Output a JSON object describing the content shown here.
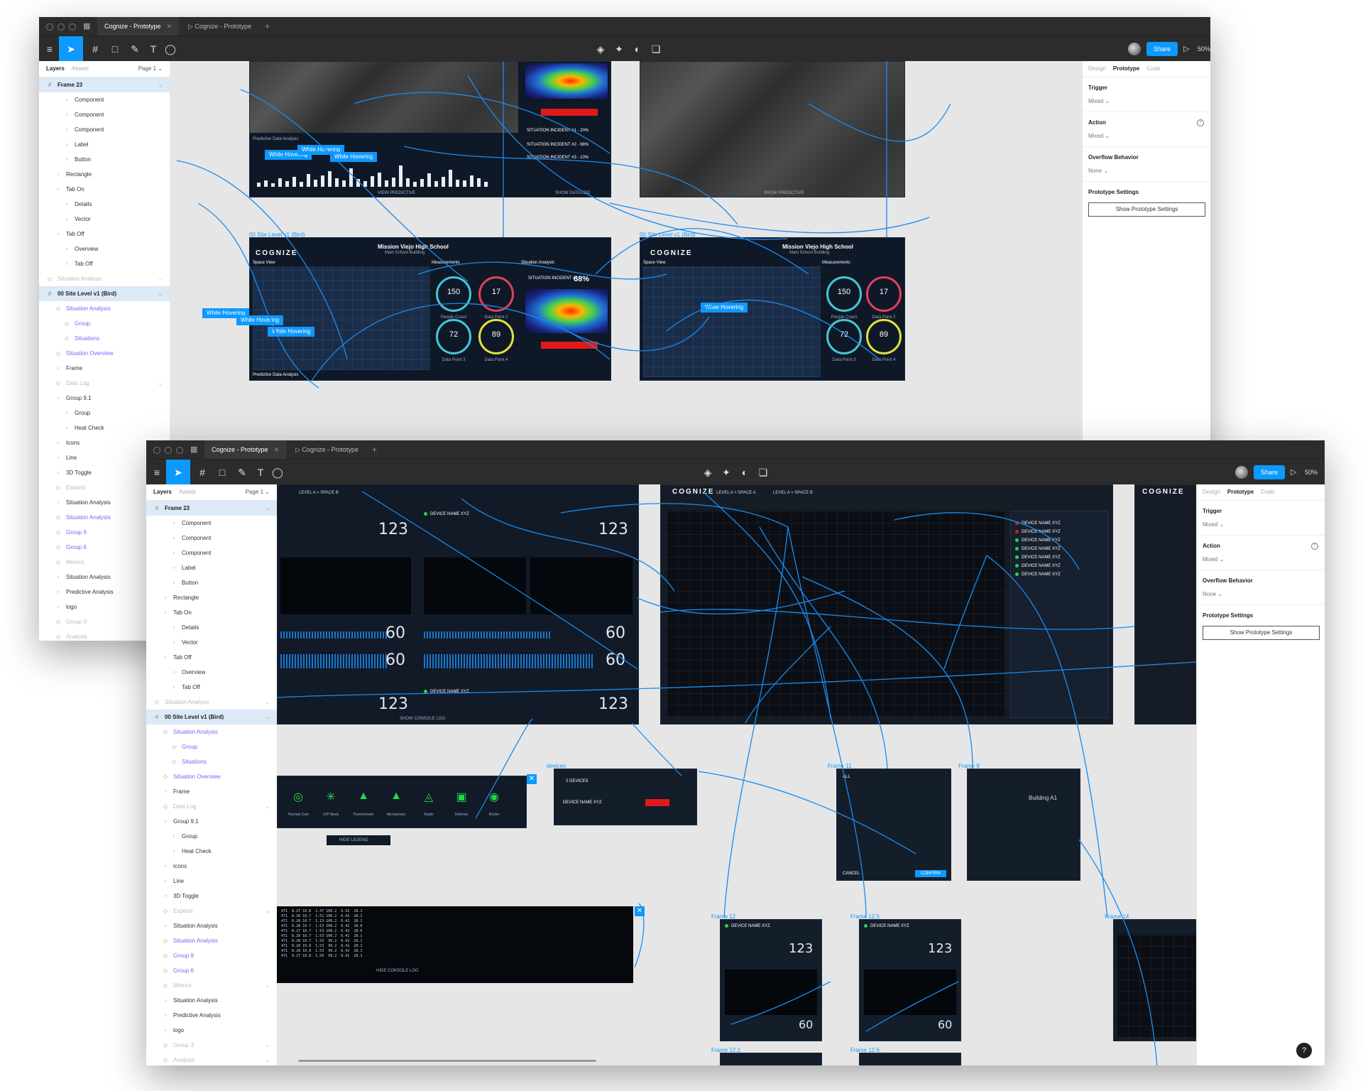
{
  "win1": {
    "tabs": [
      {
        "label": "Cognize - Prototype",
        "active": true
      },
      {
        "label": "Cognize - Prototype",
        "active": false
      }
    ],
    "zoom": "50%",
    "share_label": "Share",
    "layers_tab": "Layers",
    "assets_tab": "Assets",
    "page_label": "Page 1",
    "layers": [
      {
        "label": "Frame 23",
        "type": "frame"
      },
      {
        "label": "Component",
        "type": "normal"
      },
      {
        "label": "Component",
        "type": "normal"
      },
      {
        "label": "Component",
        "type": "normal"
      },
      {
        "label": "Label",
        "type": "normal"
      },
      {
        "label": "Button",
        "type": "normal"
      },
      {
        "label": "Rectangle",
        "type": "normal"
      },
      {
        "label": "Tab On",
        "type": "normal"
      },
      {
        "label": "Details",
        "type": "normal"
      },
      {
        "label": "Vector",
        "type": "normal"
      },
      {
        "label": "Tab Off",
        "type": "normal"
      },
      {
        "label": "Overview",
        "type": "normal"
      },
      {
        "label": "Tab Off",
        "type": "normal"
      },
      {
        "label": "Situation Analysis",
        "type": "faded"
      },
      {
        "label": "00 Site Level v1 (Bird)",
        "type": "frame"
      },
      {
        "label": "Situation Analysis",
        "type": "comp"
      },
      {
        "label": "Group",
        "type": "comp"
      },
      {
        "label": "Situations",
        "type": "comp"
      },
      {
        "label": "Situation Overview",
        "type": "comp"
      },
      {
        "label": "Frame",
        "type": "normal"
      },
      {
        "label": "Data Log",
        "type": "faded"
      },
      {
        "label": "Group 9.1",
        "type": "normal"
      },
      {
        "label": "Group",
        "type": "normal"
      },
      {
        "label": "Heat Check",
        "type": "normal"
      },
      {
        "label": "Icons",
        "type": "normal"
      },
      {
        "label": "Line",
        "type": "normal"
      },
      {
        "label": "3D Toggle",
        "type": "normal"
      },
      {
        "label": "Expand",
        "type": "faded"
      },
      {
        "label": "Situation Analysis",
        "type": "normal"
      },
      {
        "label": "Situation Analysis",
        "type": "comp"
      },
      {
        "label": "Group 9",
        "type": "comp"
      },
      {
        "label": "Group 6",
        "type": "comp"
      },
      {
        "label": "Metrics",
        "type": "faded"
      },
      {
        "label": "Situation Analysis",
        "type": "normal"
      },
      {
        "label": "Predictive Analysis",
        "type": "normal"
      },
      {
        "label": "logo",
        "type": "normal"
      },
      {
        "label": "Group 3",
        "type": "faded"
      },
      {
        "label": "Analysis",
        "type": "faded"
      }
    ],
    "props": {
      "tabs": [
        "Design",
        "Prototype",
        "Code"
      ],
      "trigger_h": "Trigger",
      "trigger_v": "Mixed",
      "action_h": "Action",
      "action_v": "Mixed",
      "overflow_h": "Overflow Behavior",
      "overflow_v": "None",
      "proto_h": "Prototype Settings",
      "proto_btn": "Show Prototype Settings"
    },
    "frame_labels": [
      "00 Site Level v1 (Bird)",
      "00 Site Level v1 (Bird)"
    ],
    "site_title": "Mission Viejo High School",
    "site_sub": "Main School Building",
    "logo": "COGNIZE",
    "space_view": "Space View",
    "measurements": "Measurements",
    "situation_analysis": "Situation Analysis",
    "predictive": "Predictive Data Analysis",
    "percent": "68%",
    "gauges": [
      {
        "value": "150",
        "label": "People Count"
      },
      {
        "value": "17",
        "label": "Data Point 2"
      },
      {
        "value": "72",
        "label": "Data Point 3"
      },
      {
        "value": "89",
        "label": "Data Point 4"
      }
    ],
    "incidents": [
      "SITUATION INCIDENT #1 - 20%",
      "SITUATION INCIDENT #2 - 98%",
      "SITUATION INCIDENT #3 - 10%"
    ],
    "incident4": "SITUATION INCIDENT #4",
    "hover_labels": [
      "While Hovering",
      "While Hovering",
      "While Hovering",
      "While Hovering",
      "While Hovering",
      "While Hovering",
      "While Hovering"
    ],
    "view_predictive": "VIEW PREDICTIVE",
    "show_data_log": "SHOW DATA LOG",
    "show_predictive": "SHOW PREDICTIVE"
  },
  "win2": {
    "tabs": [
      {
        "label": "Cognize - Prototype",
        "active": true
      },
      {
        "label": "Cognize - Prototype",
        "active": false
      }
    ],
    "zoom": "50%",
    "share_label": "Share",
    "layers_tab": "Layers",
    "assets_tab": "Assets",
    "page_label": "Page 1",
    "layers": [
      {
        "label": "Frame 23",
        "type": "frame"
      },
      {
        "label": "Component",
        "type": "normal"
      },
      {
        "label": "Component",
        "type": "normal"
      },
      {
        "label": "Component",
        "type": "normal"
      },
      {
        "label": "Label",
        "type": "normal"
      },
      {
        "label": "Button",
        "type": "normal"
      },
      {
        "label": "Rectangle",
        "type": "normal"
      },
      {
        "label": "Tab On",
        "type": "normal"
      },
      {
        "label": "Details",
        "type": "normal"
      },
      {
        "label": "Vector",
        "type": "normal"
      },
      {
        "label": "Tab Off",
        "type": "normal"
      },
      {
        "label": "Overview",
        "type": "normal"
      },
      {
        "label": "Tab Off",
        "type": "normal"
      },
      {
        "label": "Situation Analysis",
        "type": "faded"
      },
      {
        "label": "00 Site Level v1 (Bird)",
        "type": "frame"
      },
      {
        "label": "Situation Analysis",
        "type": "comp"
      },
      {
        "label": "Group",
        "type": "comp"
      },
      {
        "label": "Situations",
        "type": "comp"
      },
      {
        "label": "Situation Overview",
        "type": "comp"
      },
      {
        "label": "Frame",
        "type": "normal"
      },
      {
        "label": "Data Log",
        "type": "faded"
      },
      {
        "label": "Group 9.1",
        "type": "normal"
      },
      {
        "label": "Group",
        "type": "normal"
      },
      {
        "label": "Heat Check",
        "type": "normal"
      },
      {
        "label": "Icons",
        "type": "normal"
      },
      {
        "label": "Line",
        "type": "normal"
      },
      {
        "label": "3D Toggle",
        "type": "normal"
      },
      {
        "label": "Expand",
        "type": "faded"
      },
      {
        "label": "Situation Analysis",
        "type": "normal"
      },
      {
        "label": "Situation Analysis",
        "type": "comp"
      },
      {
        "label": "Group 9",
        "type": "comp"
      },
      {
        "label": "Group 6",
        "type": "comp"
      },
      {
        "label": "Metrics",
        "type": "faded"
      },
      {
        "label": "Situation Analysis",
        "type": "normal"
      },
      {
        "label": "Predictive Analysis",
        "type": "normal"
      },
      {
        "label": "logo",
        "type": "normal"
      },
      {
        "label": "Group 3",
        "type": "faded"
      },
      {
        "label": "Analysis",
        "type": "faded"
      }
    ],
    "props": {
      "tabs": [
        "Design",
        "Prototype",
        "Code"
      ],
      "trigger_h": "Trigger",
      "trigger_v": "Mixed",
      "action_h": "Action",
      "action_v": "Mixed",
      "overflow_h": "Overflow Behavior",
      "overflow_v": "None",
      "proto_h": "Prototype Settings",
      "proto_btn": "Show Prototype Settings"
    },
    "frame_labels": [
      "devices",
      "Frame 11",
      "Frame 9",
      "Frame 12",
      "Frame 12.5",
      "Frame 14",
      "Frame 12.1",
      "Frame 12.6"
    ],
    "level_tabs": [
      "LEVEL A > SPACE B",
      "LEVEL A > SPACE A",
      "LEVEL A > SPACE B"
    ],
    "logo": "COGNIZE",
    "big_numbers": [
      "123",
      "123",
      "60",
      "60",
      "123",
      "123",
      "60",
      "60",
      "123",
      "123",
      "60",
      "60"
    ],
    "device_name": "DEVICE NAME XYZ",
    "devices_count": "2 DEVICES",
    "legend_items": [
      "Thermal Cam",
      "LVP Mesh",
      "Thermometer",
      "Microphone",
      "Radio",
      "Defense",
      "Router"
    ],
    "hide_legend": "HIDE LEGEND",
    "hide_console": "HIDE CONSOLE LOG",
    "show_console": "SHOW CONSOLE LOG",
    "device_rows": [
      "DEVICE NAME XYZ",
      "DEVICE NAME XYZ",
      "DEVICE NAME XYZ",
      "DEVICE NAME XYZ",
      "DEVICE NAME XYZ",
      "DEVICE NAME XYZ",
      "DEVICE NAME XYZ"
    ],
    "building_title": "Building A1",
    "cancel": "CANCEL",
    "confirm": "CONFIRM",
    "all_label": "ALL",
    "help": "?"
  },
  "colors": {
    "accent": "#0d99ff",
    "dark": "#2c2c2c",
    "frame_bg": "#0f1826",
    "alert": "#e01a1a",
    "green": "#21d84a"
  }
}
